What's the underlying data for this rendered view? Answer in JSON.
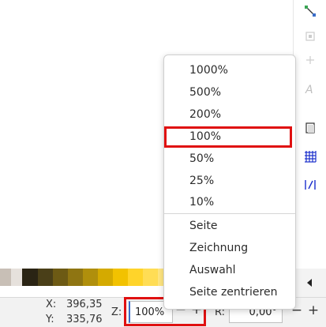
{
  "zoom_menu": {
    "items": [
      {
        "label": "1000%"
      },
      {
        "label": "500%"
      },
      {
        "label": "200%"
      },
      {
        "label": "100%"
      },
      {
        "label": "50%"
      },
      {
        "label": "25%"
      },
      {
        "label": "10%"
      }
    ],
    "fit_items": [
      {
        "label": "Seite"
      },
      {
        "label": "Zeichnung"
      },
      {
        "label": "Auswahl"
      },
      {
        "label": "Seite zentrieren"
      }
    ],
    "highlighted_item": "100%"
  },
  "statusbar": {
    "x_label": "X:",
    "x_value": "396,35",
    "y_label": "Y:",
    "y_value": "335,76",
    "zoom_label": "Z:",
    "zoom_value": "100%",
    "zoom_minus": "−",
    "zoom_plus": "+",
    "rotation_label": "R:",
    "rotation_value": "0,00°",
    "rotation_minus": "−",
    "rotation_plus": "+"
  },
  "palette": {
    "swatches": [
      "#c8bfb6",
      "#e6e1dc",
      "#2a2414",
      "#4a3f18",
      "#6d5a14",
      "#8f7512",
      "#b08f0c",
      "#d4aa00",
      "#f2c200",
      "#ffd42a",
      "#ffdd55",
      "#ffe680",
      "#fff0aa"
    ]
  },
  "toolbar": {
    "icons": [
      "node-snap-icon",
      "snap-bbox-icon",
      "snap-midpoint-icon",
      "text-baseline-icon",
      "page-border-icon",
      "grid-icon",
      "guide-icon"
    ]
  },
  "colors": {
    "highlight": "#e01010",
    "grid_icon": "#1a2ecc",
    "accent": "#3a6ec9"
  }
}
